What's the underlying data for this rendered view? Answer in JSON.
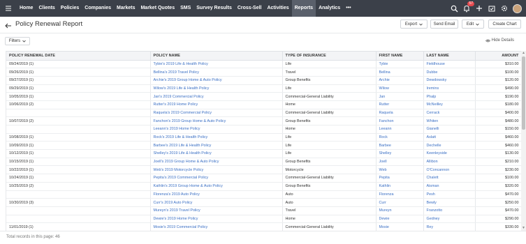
{
  "nav": {
    "items": [
      "Home",
      "Clients",
      "Policies",
      "Companies",
      "Markets",
      "Market Quotes",
      "SMS",
      "Survey Results",
      "Cross-Sell",
      "Activities",
      "Reports",
      "Analytics"
    ],
    "active": "Reports",
    "more": "•••",
    "notification_count": "57"
  },
  "page": {
    "title": "Policy Renewal Report",
    "export_label": "Export",
    "send_email_label": "Send Email",
    "edit_label": "Edit",
    "create_chart_label": "Create Chart",
    "filters_label": "Filters",
    "hide_details_label": "Hide Details"
  },
  "table": {
    "columns": [
      "POLICY RENEWAL DATE",
      "POLICY NAME",
      "TYPE OF INSURANCE",
      "FIRST NAME",
      "LAST NAME",
      "AMOUNT"
    ],
    "rows": [
      [
        "09/24/2019 (1)",
        "Tybie's 2019 Life & Health Policy",
        "Life",
        "Tybie",
        "Fieldhouse",
        "$310.00"
      ],
      [
        "09/26/2019 (1)",
        "Bellina's 2019 Travel Policy",
        "Travel",
        "Bellina",
        "Dubbe",
        "$100.00"
      ],
      [
        "09/27/2019 (1)",
        "Archie's 2019 Group Home & Auto Policy",
        "Group Benefits",
        "Archie",
        "Dewdowsky",
        "$120.00"
      ],
      [
        "09/29/2019 (1)",
        "Wilow's 2019 Life & Health Policy",
        "Life",
        "Wilow",
        "Iremins",
        "$490.00"
      ],
      [
        "10/05/2019 (1)",
        "Jan's 2019 Commercial Policy",
        "Commercial-General Liability",
        "Jan",
        "Phalp",
        "$190.00"
      ],
      [
        "10/06/2019 (2)",
        "Rutter's 2019 Home Policy",
        "Home",
        "Rutter",
        "McNeilley",
        "$180.00"
      ],
      [
        "",
        "Raquela's 2019 Commercial Policy",
        "Commercial-General Liability",
        "Raquela",
        "Cerrack",
        "$400.00"
      ],
      [
        "10/07/2019 (2)",
        "Fanchon's 2019 Group Home & Auto Policy",
        "Group Benefits",
        "Fanchon",
        "Whiten",
        "$480.00"
      ],
      [
        "",
        "Leeann's 2019 Home Policy",
        "Home",
        "Leeann",
        "Gianelli",
        "$150.00"
      ],
      [
        "10/08/2019 (1)",
        "Rock's 2019 Life & Health Policy",
        "Life",
        "Rock",
        "Aslatt",
        "$460.00"
      ],
      [
        "10/09/2019 (1)",
        "Barbee's 2019 Life & Health Policy",
        "Life",
        "Barbee",
        "Dechelle",
        "$460.00"
      ],
      [
        "10/12/2019 (1)",
        "Shelley's 2019 Life & Health Policy",
        "Life",
        "Shelley",
        "Keenleyside",
        "$130.00"
      ],
      [
        "10/15/2019 (1)",
        "Joell's 2019 Group Home & Auto Policy",
        "Group Benefits",
        "Joell",
        "Allibon",
        "$210.00"
      ],
      [
        "10/22/2019 (1)",
        "Web's 2019 Motorcycle Policy",
        "Motorcycle",
        "Web",
        "O'Concannon",
        "$230.00"
      ],
      [
        "10/24/2019 (1)",
        "Pepita's 2019 Commercial Policy",
        "Commercial-General Liability",
        "Pepita",
        "Chalett",
        "$100.00"
      ],
      [
        "10/25/2019 (2)",
        "Kathlin's 2019 Group Home & Auto Policy",
        "Group Benefits",
        "Kathlin",
        "Aisman",
        "$320.00"
      ],
      [
        "",
        "Florenza's 2019 Auto Policy",
        "Auto",
        "Florenza",
        "Pesh",
        "$470.00"
      ],
      [
        "10/30/2019 (3)",
        "Curr's 2019 Auto Policy",
        "Auto",
        "Curr",
        "Bewly",
        "$250.00"
      ],
      [
        "",
        "Mureyn's 2019 Travel Policy",
        "Travel",
        "Mureyn",
        "Franzotto",
        "$470.00"
      ],
      [
        "",
        "Dewie's 2019 Home Policy",
        "Home",
        "Dewie",
        "Gedney",
        "$290.00"
      ],
      [
        "11/01/2019 (1)",
        "Mosie's 2019 Commercial Policy",
        "Commercial-General Liability",
        "Mosie",
        "Rey",
        "$330.00"
      ]
    ]
  },
  "footer": {
    "total_text": "Total records in this page: 46"
  },
  "colors": {
    "nav_bg": "#3b4049",
    "link": "#3a6fc4",
    "badge": "#e5484d"
  }
}
